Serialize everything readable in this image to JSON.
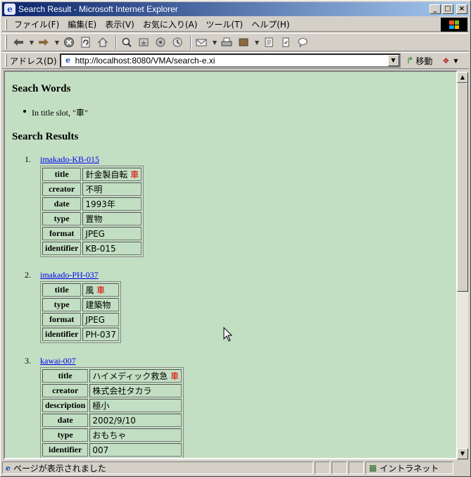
{
  "window": {
    "title": "Search Result - Microsoft Internet Explorer",
    "controls": {
      "minimize": "_",
      "maximize": "□",
      "close": "×"
    }
  },
  "menu": [
    "ファイル(F)",
    "編集(E)",
    "表示(V)",
    "お気に入り(A)",
    "ツール(T)",
    "ヘルプ(H)"
  ],
  "toolbar": {
    "icons": [
      "back-icon",
      "forward-icon",
      "stop-icon",
      "refresh-icon",
      "home-icon",
      "search-icon",
      "favorites-icon",
      "media-icon",
      "history-icon",
      "mail-icon",
      "print-icon",
      "edit-icon",
      "discuss-icon",
      "messenger-icon"
    ]
  },
  "address": {
    "label": "アドレス(D)",
    "url": "http://localhost:8080/VMA/search-e.xi",
    "go_label": "移動"
  },
  "page": {
    "search_words_heading": "Seach Words",
    "search_word": "In title slot, \"車\"",
    "results_heading": "Search Results",
    "results": [
      {
        "num": "1.",
        "id": "imakado-KB-015",
        "fields": [
          {
            "key": "title",
            "value": "針金製自転",
            "hit": "車"
          },
          {
            "key": "creator",
            "value": "不明"
          },
          {
            "key": "date",
            "value": "1993年"
          },
          {
            "key": "type",
            "value": "置物"
          },
          {
            "key": "format",
            "value": "JPEG"
          },
          {
            "key": "identifier",
            "value": "KB-015"
          }
        ]
      },
      {
        "num": "2.",
        "id": "imakado-PH-037",
        "fields": [
          {
            "key": "title",
            "value": "風",
            "hit": "車"
          },
          {
            "key": "type",
            "value": "建築物"
          },
          {
            "key": "format",
            "value": "JPEG"
          },
          {
            "key": "identifier",
            "value": "PH-037"
          }
        ]
      },
      {
        "num": "3.",
        "id": "kawai-007",
        "fields": [
          {
            "key": "title",
            "value": "ハイメディック救急",
            "hit": "車"
          },
          {
            "key": "creator",
            "value": "株式会社タカラ"
          },
          {
            "key": "description",
            "value": "極小"
          },
          {
            "key": "date",
            "value": "2002/9/10"
          },
          {
            "key": "type",
            "value": "おもちゃ"
          },
          {
            "key": "identifier",
            "value": "007"
          }
        ]
      }
    ]
  },
  "status": {
    "text": "ページが表示されました",
    "zone": "イントラネット"
  },
  "colors": {
    "content_bg": "#c3dfc3",
    "highlight": "#e00000",
    "link": "#0000ee",
    "titlebar_start": "#0a246a",
    "titlebar_end": "#a6caf0"
  }
}
